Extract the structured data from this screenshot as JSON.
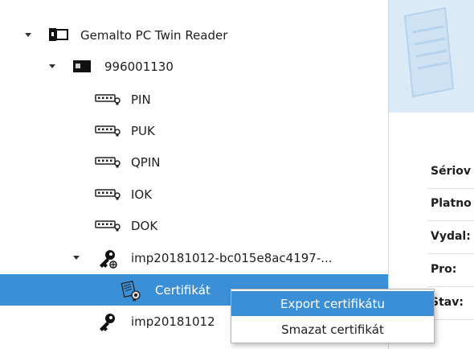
{
  "tree": {
    "reader": {
      "label": "Gemalto PC Twin Reader",
      "icon": "card-reader-icon"
    },
    "card": {
      "label": "996001130",
      "icon": "smart-card-icon"
    },
    "pins": [
      {
        "label": "PIN",
        "icon": "pin-keypad-icon"
      },
      {
        "label": "PUK",
        "icon": "pin-keypad-icon"
      },
      {
        "label": "QPIN",
        "icon": "pin-keypad-icon"
      },
      {
        "label": "IOK",
        "icon": "pin-keypad-icon"
      },
      {
        "label": "DOK",
        "icon": "pin-keypad-icon"
      }
    ],
    "key1": {
      "label": "imp20181012-bc015e8ac4197-...",
      "icon": "key-icon"
    },
    "certificate": {
      "label": "Certifikát",
      "icon": "certificate-icon"
    },
    "key2": {
      "label": "imp20181012",
      "icon": "key-icon"
    }
  },
  "details": {
    "labels": [
      "Sériov",
      "Platno",
      "Vydal:",
      "Pro:",
      "Stav:"
    ]
  },
  "context_menu": {
    "items": [
      "Export certifikátu",
      "Smazat certifikát"
    ]
  },
  "colors": {
    "selection": "#3b8fd7",
    "banner": "#dbeaf7"
  }
}
